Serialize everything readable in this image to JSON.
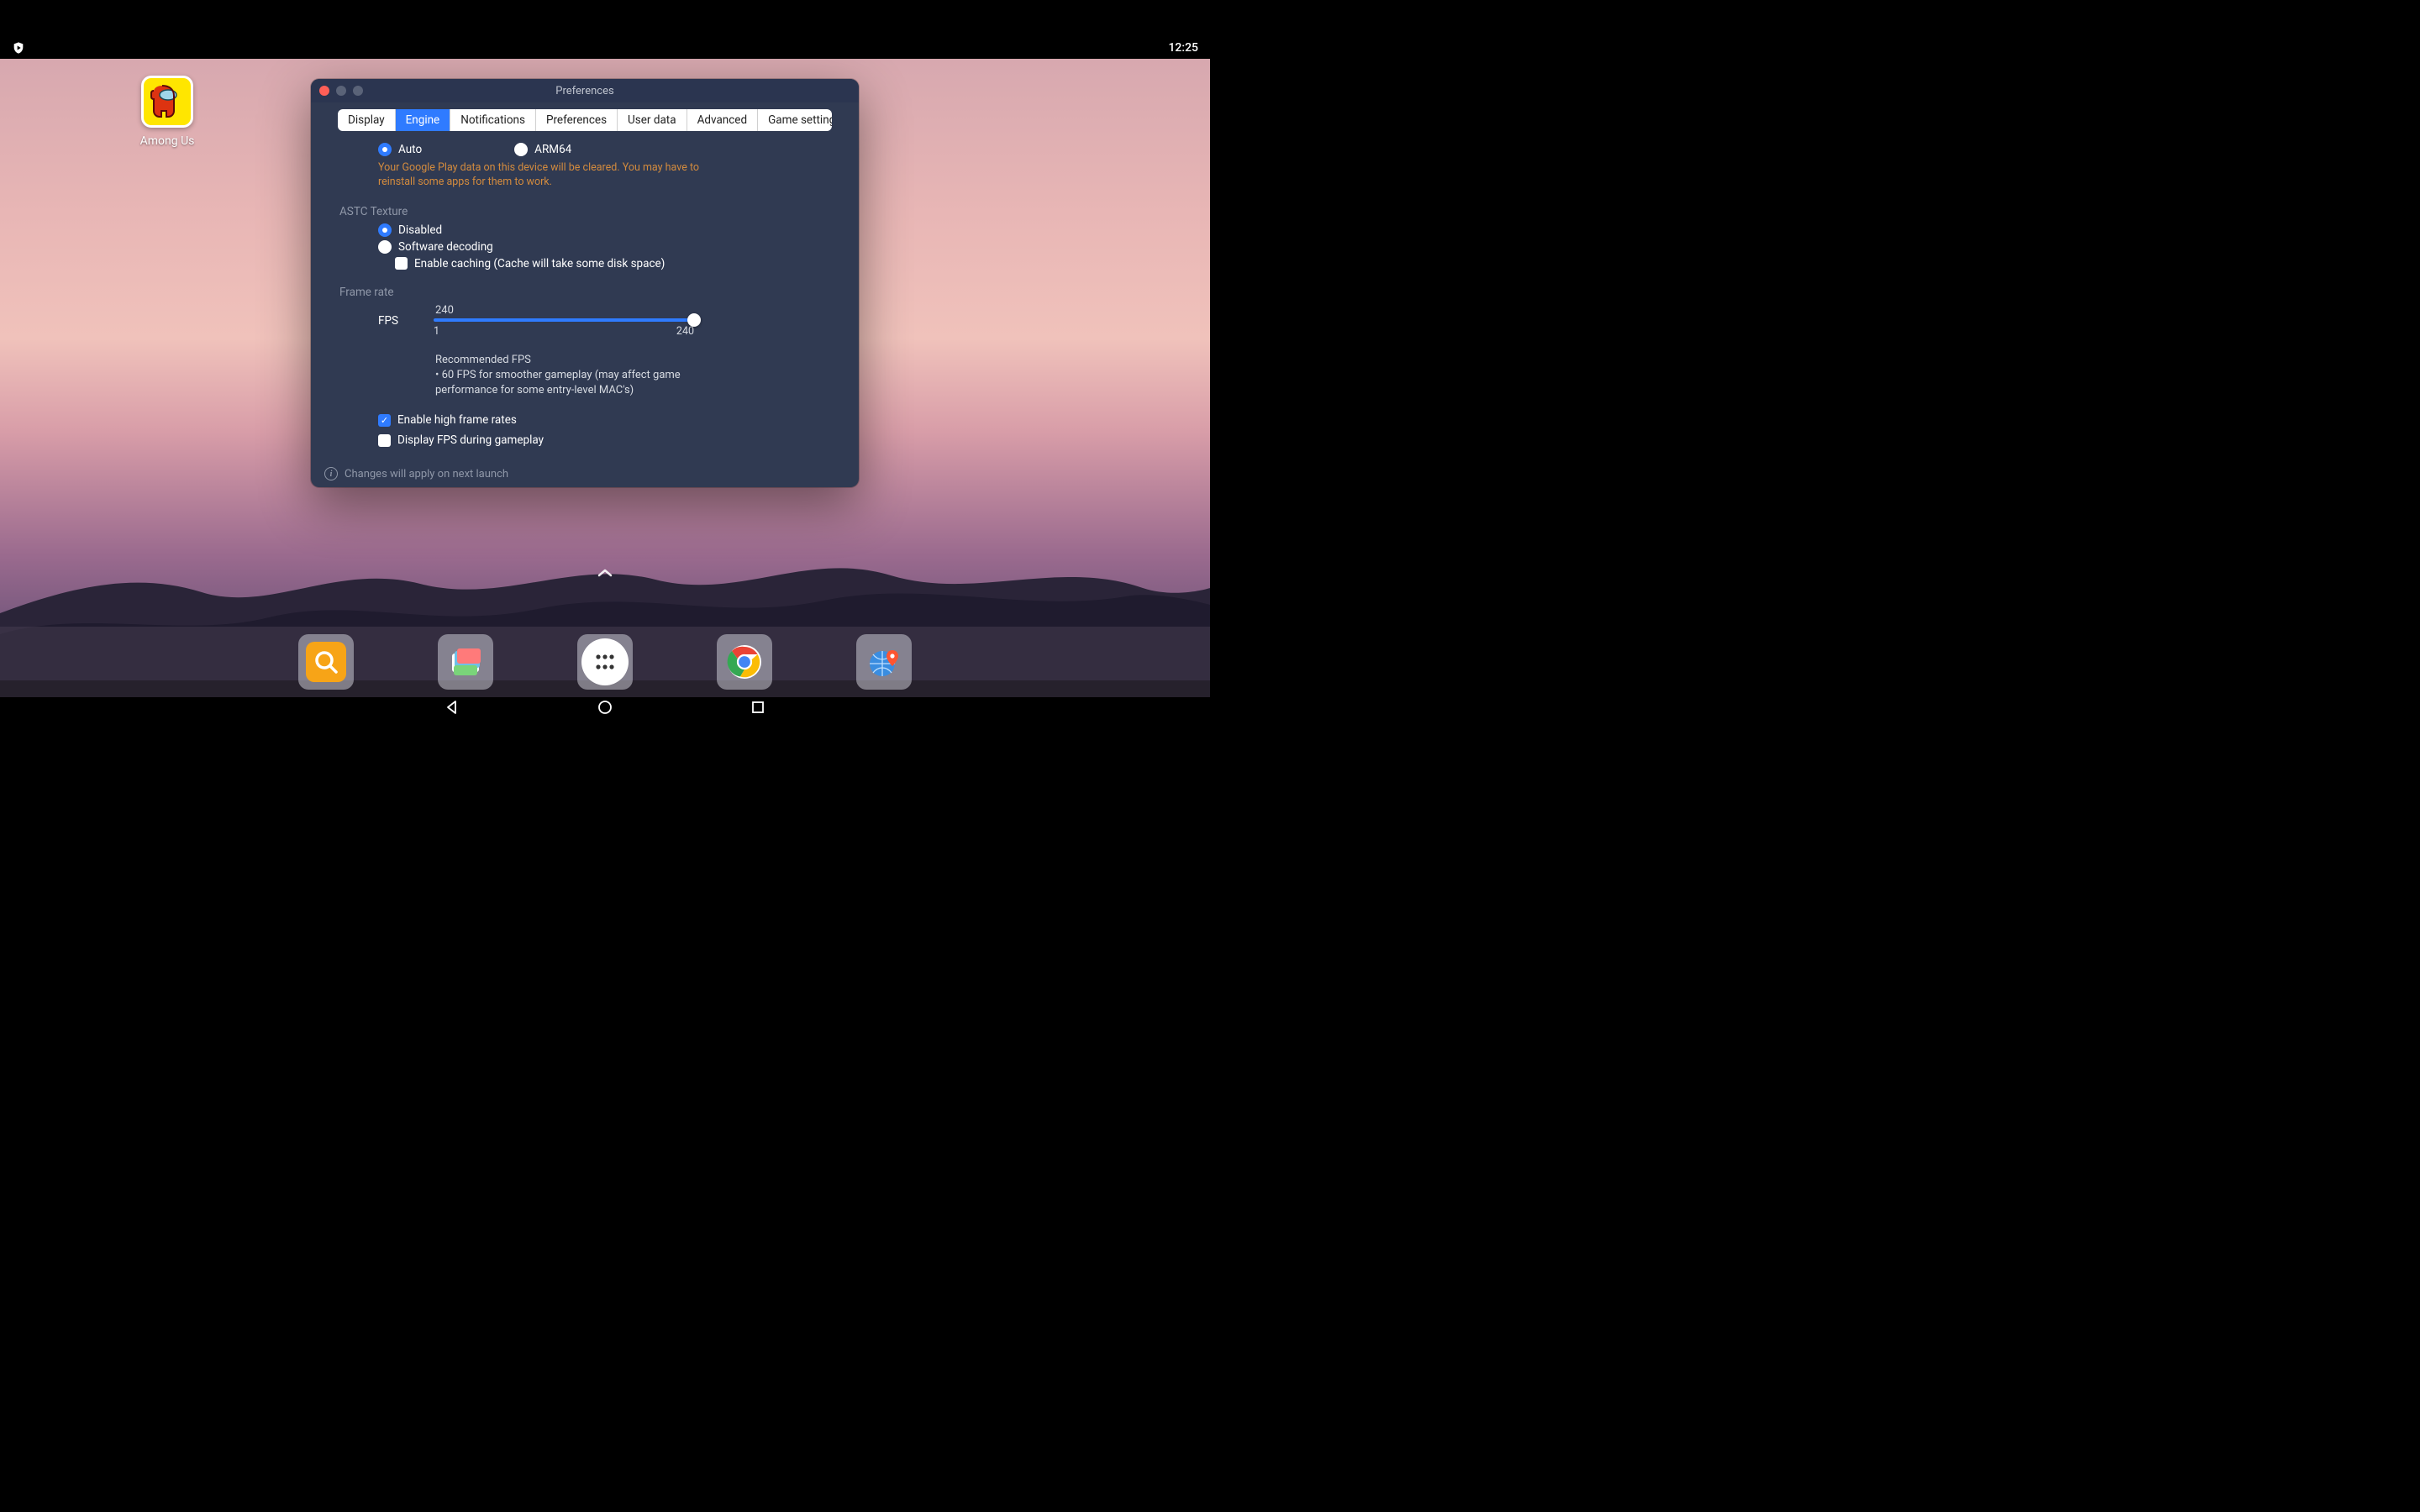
{
  "statusbar": {
    "time": "12:25"
  },
  "desktop": {
    "app_label": "Among Us"
  },
  "dock_arrow": "⌃",
  "prefs": {
    "title": "Preferences",
    "tabs": [
      "Display",
      "Engine",
      "Notifications",
      "Preferences",
      "User data",
      "Advanced",
      "Game settings"
    ],
    "active_tab_index": 1,
    "arch": {
      "options": [
        "Auto",
        "ARM64"
      ],
      "selected_index": 0,
      "warning": "Your Google Play data on this device will be cleared. You may have to reinstall some apps for them to work."
    },
    "astc": {
      "section_label": "ASTC Texture",
      "options": [
        "Disabled",
        "Software decoding"
      ],
      "selected_index": 0,
      "caching_label": "Enable caching (Cache will take some disk space)",
      "caching_checked": false
    },
    "frame_rate": {
      "section_label": "Frame rate",
      "fps_label": "FPS",
      "value": 240,
      "min": 1,
      "max": 240,
      "min_label": "1",
      "max_label": "240",
      "recommended_title": "Recommended FPS",
      "recommended_body": "• 60 FPS for smoother gameplay (may affect game performance for some entry-level MAC's)",
      "enable_high_label": "Enable high frame rates",
      "enable_high_checked": true,
      "display_fps_label": "Display FPS during gameplay",
      "display_fps_checked": false
    },
    "footer": "Changes will apply on next launch"
  }
}
